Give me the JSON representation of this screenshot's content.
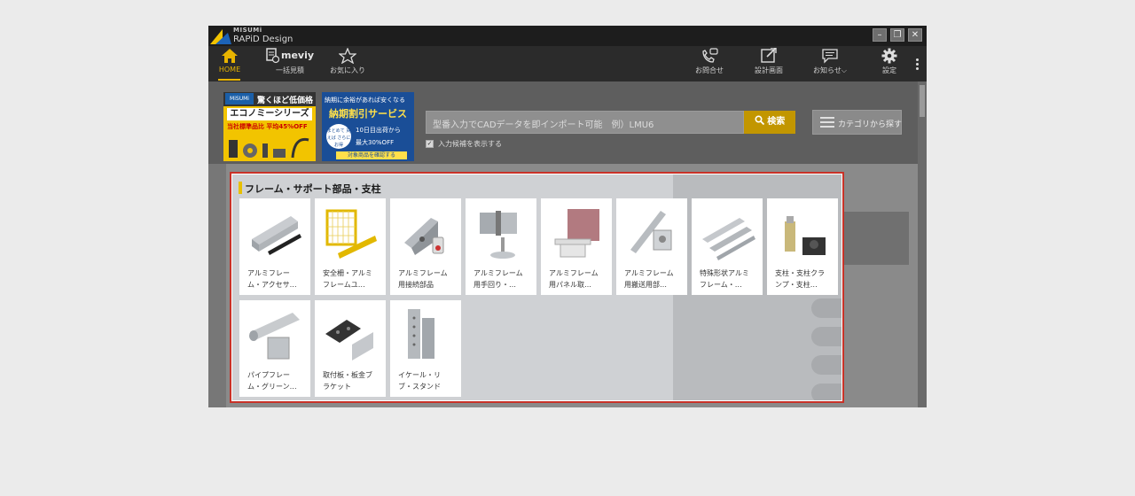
{
  "app": {
    "brand_top": "MISUMi",
    "brand_name": "RAPiD Design"
  },
  "window_controls": {
    "minimize": "–",
    "restore": "❐",
    "close": "✕"
  },
  "toolbar": {
    "home": "HOME",
    "meviy_logo": "meviy",
    "bulk_estimate": "一括見積",
    "favorites": "お気に入り",
    "contact": "お問合せ",
    "design_screen": "設計画面",
    "notice": "お知らせ⌵",
    "settings": "設定"
  },
  "banner_economy": {
    "brand": "MiSUMi economy",
    "subtitle": "驚くほど低価格",
    "title": "エコノミーシリーズ",
    "discount": "当社標準品比 平均45%OFF"
  },
  "banner_delivery": {
    "subtitle": "納期に余裕があれば安くなる",
    "title": "納期割引サービス",
    "circle": "まとめて 買えば さらにお得",
    "days": "10日目出荷から",
    "max": "最大30%OFF",
    "button": "対象商品を確認する"
  },
  "search": {
    "placeholder": "型番入力でCADデータを即インポート可能　例）LMU6",
    "button": "検索",
    "suggest_checked": "✓",
    "suggest_label": "入力候補を表示する"
  },
  "category_button": "カテゴリから探す",
  "panel": {
    "title": "フレーム・サポート部品・支柱",
    "items": [
      {
        "label": "アルミフレー ム・アクセサ…",
        "icon": "aluminum-frame-accessory"
      },
      {
        "label": "安全柵・アルミ フレームユ…",
        "icon": "safety-fence"
      },
      {
        "label": "アルミフレーム 用接続部品",
        "icon": "frame-connector"
      },
      {
        "label": "アルミフレーム 用手回り・…",
        "icon": "frame-hinge"
      },
      {
        "label": "アルミフレーム 用パネル取…",
        "icon": "frame-panel"
      },
      {
        "label": "アルミフレーム 用搬送用部…",
        "icon": "frame-transport"
      },
      {
        "label": "特殊形状アルミ フレーム・…",
        "icon": "special-frame"
      },
      {
        "label": "支柱・支柱クラ ンプ・支柱…",
        "icon": "post-clamp"
      },
      {
        "label": "パイプフレー ム・グリーン…",
        "icon": "pipe-frame"
      },
      {
        "label": "取付板・板金ブ ラケット",
        "icon": "mounting-plate"
      },
      {
        "label": "イケール・リ ブ・スタンド",
        "icon": "angle-plate"
      }
    ],
    "to_top": "^"
  },
  "colors": {
    "accent": "#e8b400",
    "highlight_border": "#c83228",
    "search_button": "#c29600"
  }
}
